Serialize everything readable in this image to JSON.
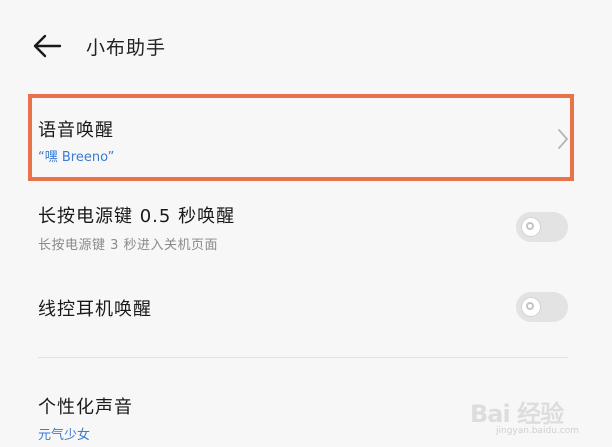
{
  "header": {
    "title": "小布助手",
    "back_icon": "back-arrow-icon"
  },
  "items": [
    {
      "title": "语音唤醒",
      "subtitle": "“嘿 Breeno”",
      "control": "chevron"
    },
    {
      "title": "长按电源键 0.5 秒唤醒",
      "subtitle": "长按电源键 3 秒进入关机页面",
      "control": "toggle",
      "on": false
    },
    {
      "title": "线控耳机唤醒",
      "control": "toggle",
      "on": false
    },
    {
      "title": "个性化声音",
      "subtitle": "元气少女",
      "control": "chevron"
    }
  ],
  "highlight_color": "#e8734a",
  "accent_color": "#3a7bd5",
  "watermark": {
    "logo": "Bai 经验",
    "url": "jingyan.baidu.com"
  }
}
